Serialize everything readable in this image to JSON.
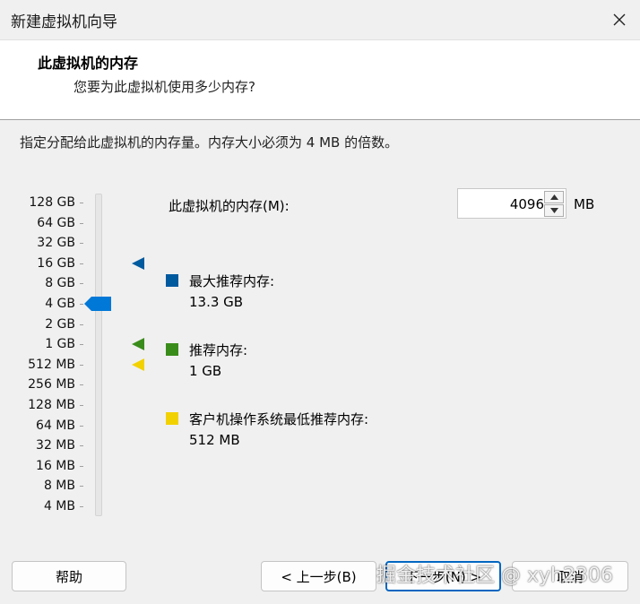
{
  "window": {
    "title": "新建虚拟机向导",
    "close_icon": "close-icon"
  },
  "header": {
    "title": "此虚拟机的内存",
    "subtitle": "您要为此虚拟机使用多少内存?"
  },
  "description": "指定分配给此虚拟机的内存量。内存大小必须为 4 MB 的倍数。",
  "memory_scale": {
    "labels": [
      "128 GB",
      "64 GB",
      "32 GB",
      "16 GB",
      "8 GB",
      "4 GB",
      "2 GB",
      "1 GB",
      "512 MB",
      "256 MB",
      "128 MB",
      "64 MB",
      "32 MB",
      "16 MB",
      "8 MB",
      "4 MB"
    ],
    "selected": "4 GB",
    "thumb_color": "#0078d7"
  },
  "memory_input": {
    "label": "此虚拟机的内存(M):",
    "value": "4096",
    "unit": "MB"
  },
  "recommendations": [
    {
      "label": "最大推荐内存:",
      "value": "13.3 GB",
      "color": "#005a9e",
      "scale_level": "16 GB"
    },
    {
      "label": "推荐内存:",
      "value": "1 GB",
      "color": "#3a8c1a",
      "scale_level": "1 GB"
    },
    {
      "label": "客户机操作系统最低推荐内存:",
      "value": "512 MB",
      "color": "#f2d100",
      "scale_level": "512 MB"
    }
  ],
  "buttons": {
    "help": "帮助",
    "back": "< 上一步(B)",
    "next": "下一步(N) >",
    "cancel": "取消"
  },
  "watermark": "掘金技术社区 @ xyh2306"
}
